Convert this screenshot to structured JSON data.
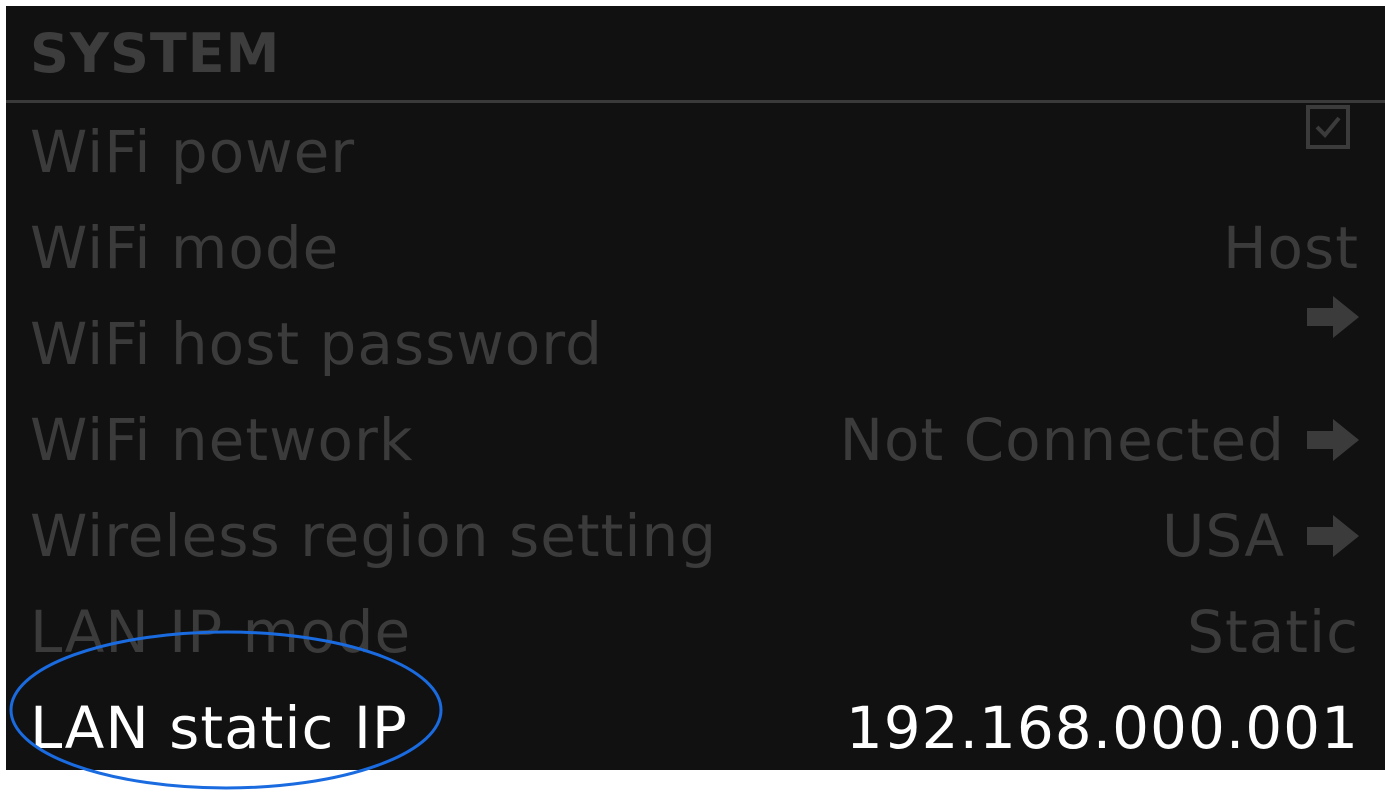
{
  "header": {
    "title": "SYSTEM"
  },
  "rows": [
    {
      "label": "WiFi power",
      "value": "",
      "control": "checkbox-checked"
    },
    {
      "label": "WiFi mode",
      "value": "Host",
      "control": "value"
    },
    {
      "label": "WiFi host password",
      "value": "",
      "control": "arrow"
    },
    {
      "label": "WiFi network",
      "value": "Not Connected",
      "control": "arrow"
    },
    {
      "label": "Wireless region setting",
      "value": "USA",
      "control": "arrow"
    },
    {
      "label": "LAN IP mode",
      "value": "Static",
      "control": "value"
    },
    {
      "label": "LAN static IP",
      "value": "192.168.000.001",
      "control": "value",
      "selected": true
    }
  ],
  "colors": {
    "background": "#111111",
    "dimmed_text": "#3b3b3b",
    "active_text": "#ffffff",
    "annotation": "#1a6be0"
  },
  "icons": {
    "checkbox": "checkbox-checked-icon",
    "arrow": "arrow-right-icon"
  }
}
